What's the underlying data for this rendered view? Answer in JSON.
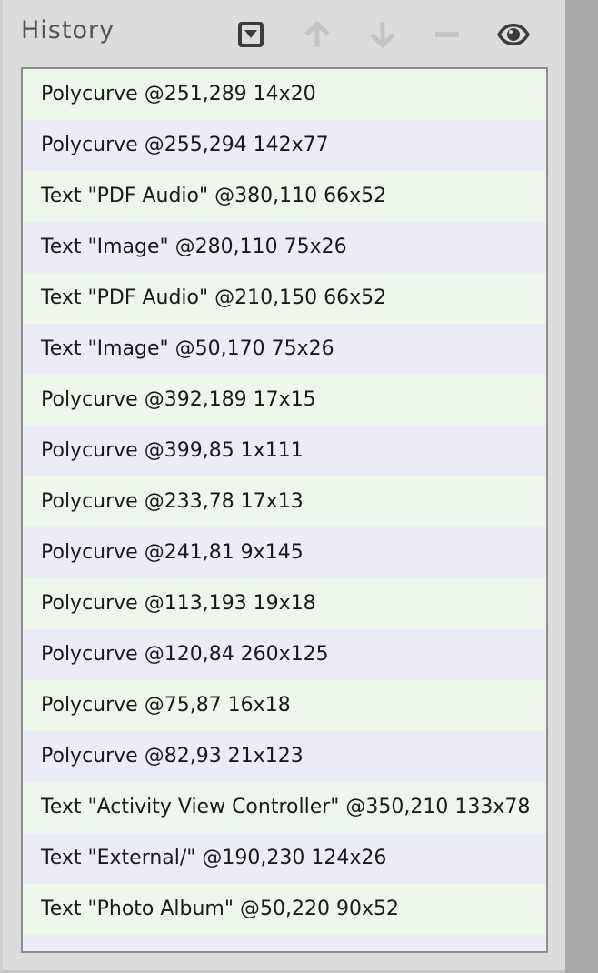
{
  "panel": {
    "title": "History"
  },
  "toolbar": {
    "buttons": [
      {
        "name": "collapse-button",
        "icon": "dropdown-square-icon",
        "enabled": true
      },
      {
        "name": "move-up-button",
        "icon": "arrow-up-icon",
        "enabled": false
      },
      {
        "name": "move-down-button",
        "icon": "arrow-down-icon",
        "enabled": false
      },
      {
        "name": "remove-button",
        "icon": "minus-icon",
        "enabled": false
      },
      {
        "name": "visibility-button",
        "icon": "eye-icon",
        "enabled": true
      }
    ]
  },
  "colors": {
    "row_even": "#eef7ec",
    "row_odd": "#ececf6",
    "panel_bg": "#dcdcdc",
    "disabled_icon": "#c4c4c4",
    "active_icon": "#3c3c3c"
  },
  "history": {
    "items": [
      "Polycurve @251,289 14x20",
      "Polycurve @255,294 142x77",
      "Text \"PDF Audio\" @380,110 66x52",
      "Text \"Image\" @280,110 75x26",
      "Text \"PDF Audio\" @210,150 66x52",
      "Text \"Image\" @50,170 75x26",
      "Polycurve @392,189 17x15",
      "Polycurve @399,85 1x111",
      "Polycurve @233,78 17x13",
      "Polycurve @241,81 9x145",
      "Polycurve @113,193 19x18",
      "Polycurve @120,84 260x125",
      "Polycurve @75,87 16x18",
      "Polycurve @82,93 21x123",
      "Text \"Activity View Controller\" @350,210 133x78",
      "Text \"External/\" @190,230 124x26",
      "Text \"Photo Album\" @50,220 90x52"
    ]
  }
}
